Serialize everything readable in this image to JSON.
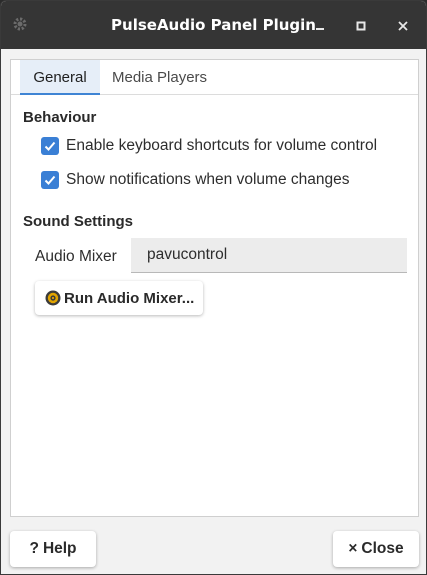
{
  "window": {
    "title": "PulseAudio Panel Plugin",
    "icons": {
      "app": "gear-icon",
      "minimize": "minimize-icon",
      "maximize": "maximize-icon",
      "close": "close-icon"
    }
  },
  "tabs": [
    {
      "label": "General",
      "active": true
    },
    {
      "label": "Media Players",
      "active": false
    }
  ],
  "behaviour": {
    "title": "Behaviour",
    "options": [
      {
        "label": "Enable keyboard shortcuts for volume control",
        "checked": true
      },
      {
        "label": "Show notifications when volume changes",
        "checked": true
      }
    ]
  },
  "sound_settings": {
    "title": "Sound Settings",
    "audio_mixer_label": "Audio Mixer",
    "audio_mixer_value": "pavucontrol",
    "run_button_label": "Run Audio Mixer...",
    "run_button_icon": "speaker-icon"
  },
  "footer": {
    "help_label": "Help",
    "help_glyph": "?",
    "close_label": "Close",
    "close_glyph": "×"
  },
  "colors": {
    "accent": "#3a7fd5",
    "titlebar": "#353535",
    "tab_active_bg": "#e6eef8"
  }
}
